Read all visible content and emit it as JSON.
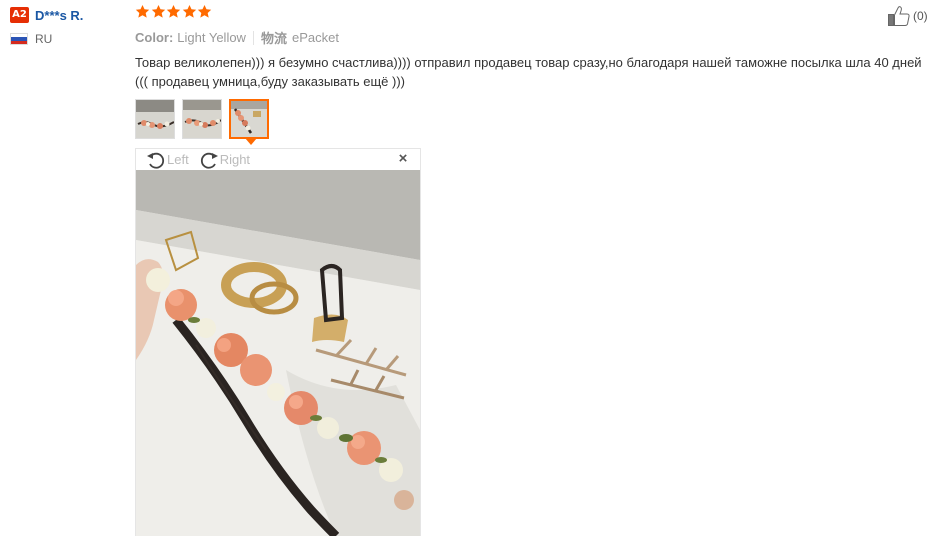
{
  "user": {
    "level_badge": "A2",
    "name": "D***s R.",
    "country_code": "RU"
  },
  "rating": {
    "stars": 5,
    "max": 5,
    "star_color": "#ff6a00"
  },
  "helpful": {
    "count_label": "(0)"
  },
  "meta": {
    "color_label": "Color:",
    "color_value": "Light Yellow",
    "logistics_label": "物流",
    "logistics_value": "ePacket"
  },
  "review": {
    "text": "Товар великолепен))) я безумно счастлива)))) отправил продавец товар сразу,но благодаря нашей таможне посылка шла 40 дней ((( продавец умница,буду заказывать ещё )))"
  },
  "photos": {
    "thumbnails": [
      {
        "name": "photo-thumb-1",
        "active": false
      },
      {
        "name": "photo-thumb-2",
        "active": false
      },
      {
        "name": "photo-thumb-3",
        "active": true
      }
    ],
    "accent_color": "#ff6a00"
  },
  "viewer": {
    "rotate_left_label": "Left",
    "rotate_right_label": "Right",
    "close_symbol": "×"
  },
  "colors": {
    "username": "#1a57a4",
    "badge": "#e62e04",
    "muted": "#999999"
  }
}
